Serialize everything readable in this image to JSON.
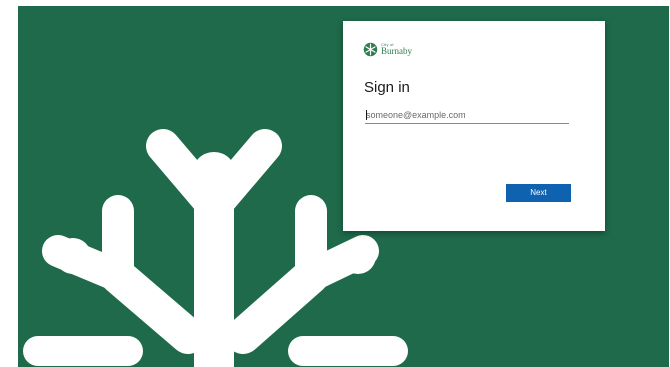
{
  "background": {
    "color": "#1e6a4b",
    "art": "white-stylized-snowflake-logo"
  },
  "brand": {
    "small_text": "City of",
    "name": "Burnaby",
    "logo_icon": "burnaby-snowflake-icon",
    "color": "#2e7d4f"
  },
  "signin": {
    "title": "Sign in",
    "email_placeholder": "someone@example.com",
    "email_value": "",
    "next_label": "Next",
    "button_color": "#0f62b0"
  }
}
